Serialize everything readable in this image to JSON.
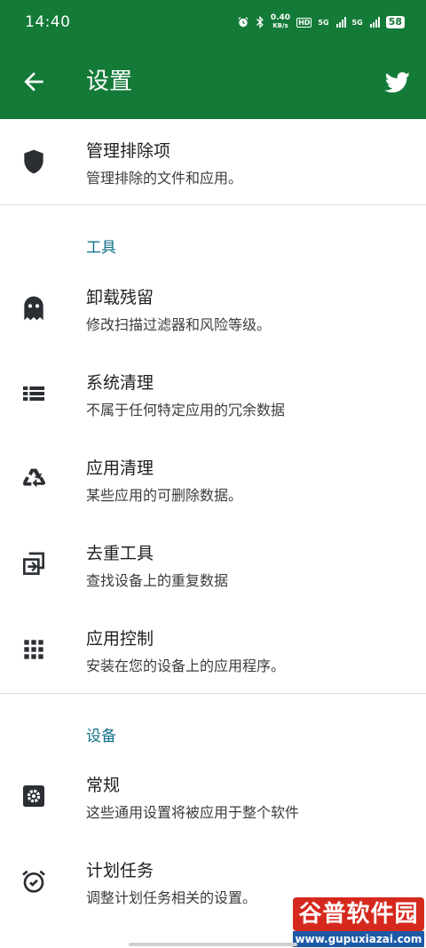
{
  "status_bar": {
    "time": "14:40",
    "net_speed_value": "0.40",
    "net_speed_unit": "KB/s",
    "hd_label": "HD",
    "sim1": "5G",
    "sim2": "5G",
    "battery": "58"
  },
  "app_bar": {
    "title": "设置",
    "back_icon": "arrow-back-icon",
    "action_icon": "twitter-icon",
    "background": "#147a38"
  },
  "top_item": {
    "title": "管理排除项",
    "subtitle": "管理排除的文件和应用。",
    "icon": "shield-icon"
  },
  "sections": [
    {
      "header": "工具",
      "items": [
        {
          "title": "卸载残留",
          "subtitle": "修改扫描过滤器和风险等级。",
          "icon": "ghost-icon"
        },
        {
          "title": "系统清理",
          "subtitle": "不属于任何特定应用的冗余数据",
          "icon": "list-icon"
        },
        {
          "title": "应用清理",
          "subtitle": "某些应用的可删除数据。",
          "icon": "recycle-icon"
        },
        {
          "title": "去重工具",
          "subtitle": "查找设备上的重复数据",
          "icon": "duplicate-icon"
        },
        {
          "title": "应用控制",
          "subtitle": "安装在您的设备上的应用程序。",
          "icon": "apps-grid-icon"
        }
      ]
    },
    {
      "header": "设备",
      "items": [
        {
          "title": "常规",
          "subtitle": "这些通用设置将被应用于整个软件",
          "icon": "settings-icon"
        },
        {
          "title": "计划任务",
          "subtitle": "调整计划任务相关的设置。",
          "icon": "alarm-icon"
        }
      ]
    }
  ],
  "watermark": {
    "text": "谷普软件园",
    "url": "www.gupuxiazai.com"
  },
  "colors": {
    "primary": "#147a38",
    "section_header": "#0f6f8a",
    "icon": "#2b2f33"
  }
}
